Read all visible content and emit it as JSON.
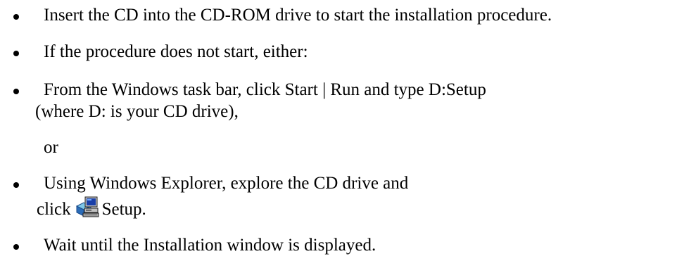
{
  "instructions": {
    "item1": "Insert the CD into the CD-ROM drive to start the installation procedure.",
    "item2": "If the procedure does not start, either:",
    "item3_line1": "From the Windows task bar, click Start | Run and type D:Setup",
    "item3_line2": "(where D: is your CD drive),",
    "or_text": "or",
    "item4_line1": "Using Windows Explorer, explore the CD drive and",
    "item4_click": "click",
    "item4_setup": "Setup.",
    "item5": "Wait until the Installation window is displayed."
  },
  "icons": {
    "bullet": "bullet-dot",
    "setup": "setup-program-icon"
  }
}
